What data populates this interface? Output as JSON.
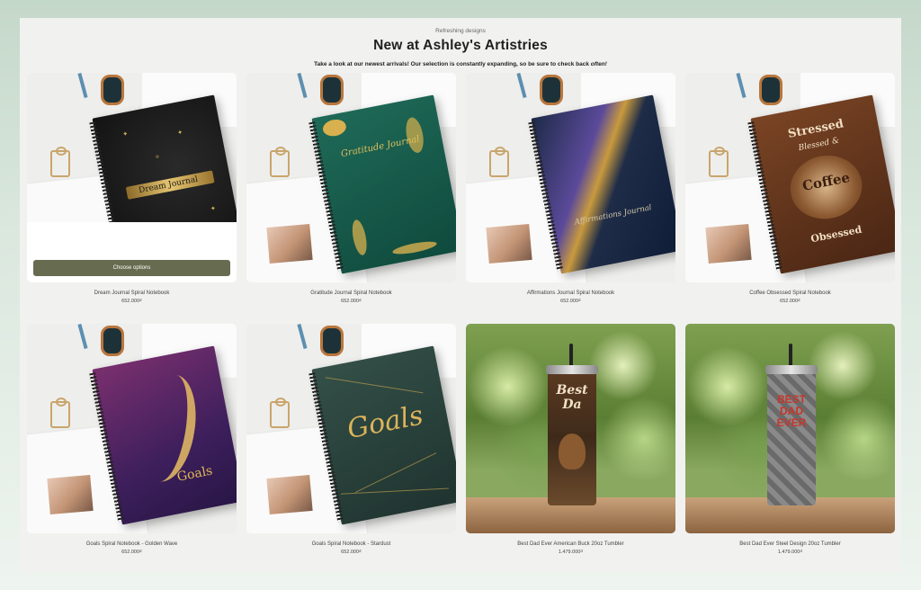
{
  "section": {
    "eyebrow": "Refreshing designs",
    "title": "New at Ashley's Artistries",
    "subtitle": "Take a look at our newest arrivals! Our selection is constantly expanding, so be sure to check back",
    "subtitle_emphasis": "often!"
  },
  "choose_options_label": "Choose options",
  "products": [
    {
      "name": "Dream Journal Spiral Notebook",
      "price": "652.000₫",
      "cover_text": "Dream Journal"
    },
    {
      "name": "Gratitude Journal Spiral Notebook",
      "price": "652.000₫",
      "cover_text": "Gratitude Journal"
    },
    {
      "name": "Affirmations Journal Spiral Notebook",
      "price": "652.000₫",
      "cover_text": "Affirmations Journal"
    },
    {
      "name": "Coffee Obsessed Spiral Notebook",
      "price": "652.000₫",
      "cover_text_1": "Stressed",
      "cover_text_2": "Blessed &",
      "cover_text_3": "Coffee",
      "cover_text_4": "Obsessed"
    },
    {
      "name": "Goals Spiral Notebook - Golden Wave",
      "price": "652.000₫",
      "cover_text": "Goals"
    },
    {
      "name": "Goals Spiral Notebook - Stardust",
      "price": "652.000₫",
      "cover_text": "Goals"
    },
    {
      "name": "Best Dad Ever American Buck 20oz Tumbler",
      "price": "1.479.000₫",
      "cover_text": "Best Da"
    },
    {
      "name": "Best Dad Ever Steel Design 20oz Tumbler",
      "price": "1.479.000₫",
      "cover_text": "BEST DAD EVER"
    }
  ]
}
